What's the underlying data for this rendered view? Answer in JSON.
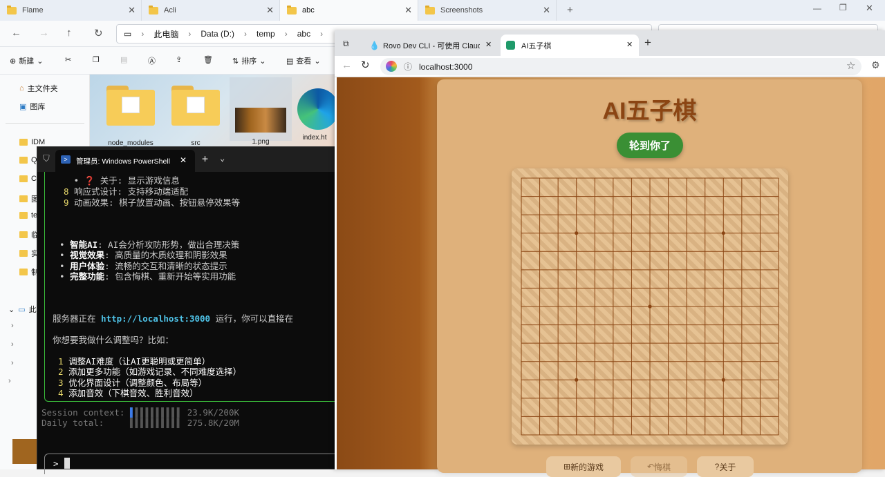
{
  "explorer": {
    "tabs": [
      "Flame",
      "Acli",
      "abc",
      "Screenshots"
    ],
    "breadcrumb": [
      "此电脑",
      "Data (D:)",
      "temp",
      "abc"
    ],
    "commands": {
      "new": "新建",
      "sort": "排序",
      "view": "查看"
    },
    "sidebar": {
      "home": "主文件夹",
      "gallery": "图库",
      "pinned": [
        "IDM",
        "Q",
        "C",
        "图",
        "te",
        "临",
        "实",
        "制"
      ],
      "this_pc": "此"
    },
    "files": [
      "node_modules",
      "src",
      "1.png",
      "index.ht"
    ]
  },
  "powershell": {
    "tab_title": "管理员: Windows PowerShell",
    "lines": [
      {
        "num": "",
        "text": "   • ❓ 关于: 显示游戏信息"
      },
      {
        "num": "8",
        "text": " 响应式设计: 支持移动端适配"
      },
      {
        "num": "9",
        "text": " 动画效果: 棋子放置动画、按钮悬停效果等"
      }
    ],
    "bullets": [
      {
        "head": "智能AI",
        "rest": ": AI会分析攻防形势，做出合理决策"
      },
      {
        "head": "视觉效果",
        "rest": ": 高质量的木质纹理和阴影效果"
      },
      {
        "head": "用户体验",
        "rest": ": 流畅的交互和清晰的状态提示"
      },
      {
        "head": "完整功能",
        "rest": ": 包含悔棋、重新开始等实用功能"
      }
    ],
    "server_prefix": "服务器正在 ",
    "server_url": "http://localhost:3000",
    "server_suffix": " 运行，你可以直接在",
    "question": "你想要我做什么调整吗？比如：",
    "options": [
      {
        "num": "1",
        "text": "调整AI难度（让AI更聪明或更简单）"
      },
      {
        "num": "2",
        "text": "添加更多功能（如游戏记录、不同难度选择）"
      },
      {
        "num": "3",
        "text": "优化界面设计（调整颜色、布局等）"
      },
      {
        "num": "4",
        "text": "添加音效（下棋音效、胜利音效）"
      }
    ],
    "session_label": "Session context:",
    "session_value": "23.9K/200K",
    "daily_label": "Daily total:",
    "daily_value": "275.8K/20M",
    "prompt": ">"
  },
  "browser": {
    "tabs": [
      "Rovo Dev CLI - 可使用 Claude Son",
      "AI五子棋"
    ],
    "url": "localhost:3000"
  },
  "game": {
    "title": "AI五子棋",
    "turn": "轮到你了",
    "board_size": 15,
    "star_points": [
      [
        3,
        3
      ],
      [
        3,
        11
      ],
      [
        7,
        7
      ],
      [
        11,
        3
      ],
      [
        11,
        11
      ]
    ],
    "buttons": [
      "新的游戏",
      "悔棋",
      "关于"
    ]
  },
  "colors": {
    "board": "#e2c090",
    "line": "#8b4513",
    "turn_bg": "#3a8f34",
    "title": "#8b4513",
    "ps_green": "#3bbf3b",
    "ps_url": "#4fc3e8"
  }
}
